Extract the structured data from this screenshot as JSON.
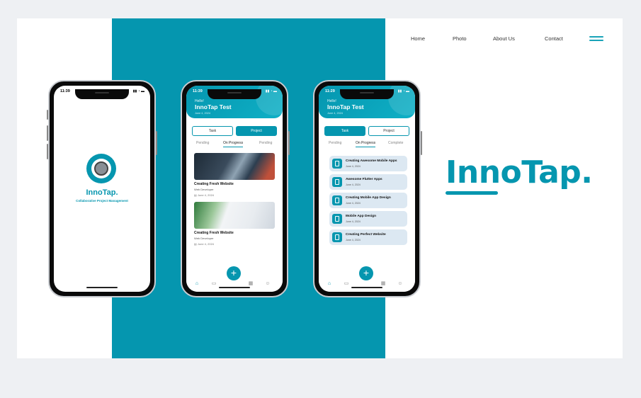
{
  "nav": {
    "home": "Home",
    "photo": "Photo",
    "about": "About Us",
    "contact": "Contact"
  },
  "brand": {
    "title": "InnoTap."
  },
  "phone1": {
    "time": "11:39",
    "status_icons": "▮▮ ◔ ▬",
    "app_name": "InnoTap.",
    "tagline": "Collaborative Project Management"
  },
  "phone2": {
    "time": "11:39",
    "status_icons": "▮▮ ◔ ▬",
    "hello": "Hello!",
    "title": "InnoTap Test",
    "date": "June 4, 2024",
    "task_btn": "Task",
    "project_btn": "Project",
    "subtabs": [
      "Pending",
      "On Progress",
      "Pending"
    ],
    "projects": [
      {
        "title": "Creating Fresh Website",
        "role": "Web Developer",
        "date": "June 4, 2024"
      },
      {
        "title": "Creating Fresh Website",
        "role": "Web Developer",
        "date": "June 4, 2024"
      }
    ],
    "fab": "+"
  },
  "phone3": {
    "time": "11:29",
    "status_icons": "▮▮ ◔ ▬",
    "hello": "Hello!",
    "title": "InnoTap Test",
    "date": "June 4, 2024",
    "task_btn": "Task",
    "project_btn": "Project",
    "subtabs": [
      "Pending",
      "On Progress",
      "Complete"
    ],
    "tasks": [
      {
        "title": "Creating Awesome Mobile Apps",
        "date": "June 4, 2024"
      },
      {
        "title": "Awesome Flutter Apps",
        "date": "June 4, 2024"
      },
      {
        "title": "Creating Mobile App Design",
        "date": "June 4, 2024"
      },
      {
        "title": "Mobile App Design",
        "date": "June 4, 2024"
      },
      {
        "title": "Creating Perfect Website",
        "date": "June 4, 2024"
      }
    ],
    "fab": "+"
  },
  "icons": {
    "home": "home-icon",
    "laptop": "laptop-icon",
    "calendar": "calendar-icon",
    "profile": "profile-icon",
    "document": "document-icon"
  },
  "colors": {
    "accent": "#0596af",
    "task_bg": "#dce8f2",
    "page_bg": "#eef0f3"
  }
}
